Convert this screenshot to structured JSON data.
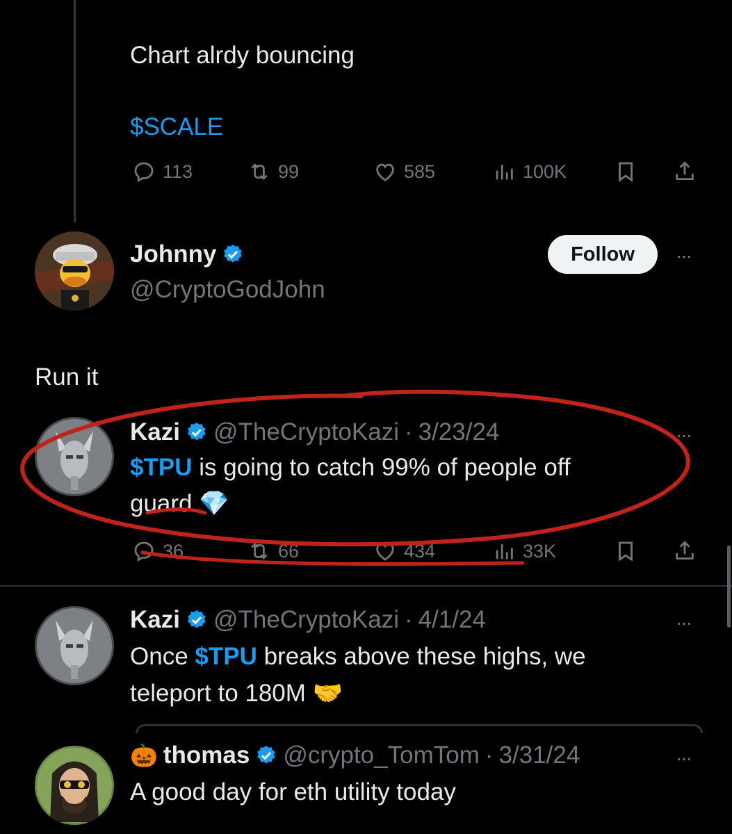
{
  "first_tweet": {
    "text": "Chart alrdy bouncing",
    "cashtag": "$SCALE",
    "actions": {
      "replies": "113",
      "reposts": "99",
      "likes": "585",
      "views": "100K"
    }
  },
  "reply_tweet": {
    "name": "Johnny",
    "handle": "@CryptoGodJohn",
    "follow_label": "Follow",
    "more": "···",
    "text": "Run it"
  },
  "quoted_tweet_1": {
    "name": "Kazi",
    "handle": "@TheCryptoKazi",
    "separator": "·",
    "date": "3/23/24",
    "cashtag": "$TPU",
    "text_rest": " is going to catch 99% of people off",
    "text_line2": "guard",
    "emoji": "💎",
    "more": "···",
    "actions": {
      "replies": "36",
      "reposts": "66",
      "likes": "434",
      "views": "33K"
    }
  },
  "quoted_tweet_2": {
    "name": "Kazi",
    "handle": "@TheCryptoKazi",
    "separator": "·",
    "date": "4/1/24",
    "text_pre": "Once ",
    "cashtag": "$TPU",
    "text_rest": " breaks above these highs, we",
    "text_line2": "teleport to 180M",
    "emoji": "🤝",
    "more": "···"
  },
  "quoted_tweet_3": {
    "name_emoji": "🎃",
    "name": "thomas",
    "handle": "@crypto_TomTom",
    "separator": "·",
    "date": "3/31/24",
    "text": "A good day for eth utility today",
    "more": "···"
  },
  "annotation": {
    "color": "#c0231a",
    "description_icon": "red-hand-drawn-circle"
  },
  "colors": {
    "accent": "#1d9bf0",
    "muted": "#71767b",
    "background": "#000000"
  }
}
